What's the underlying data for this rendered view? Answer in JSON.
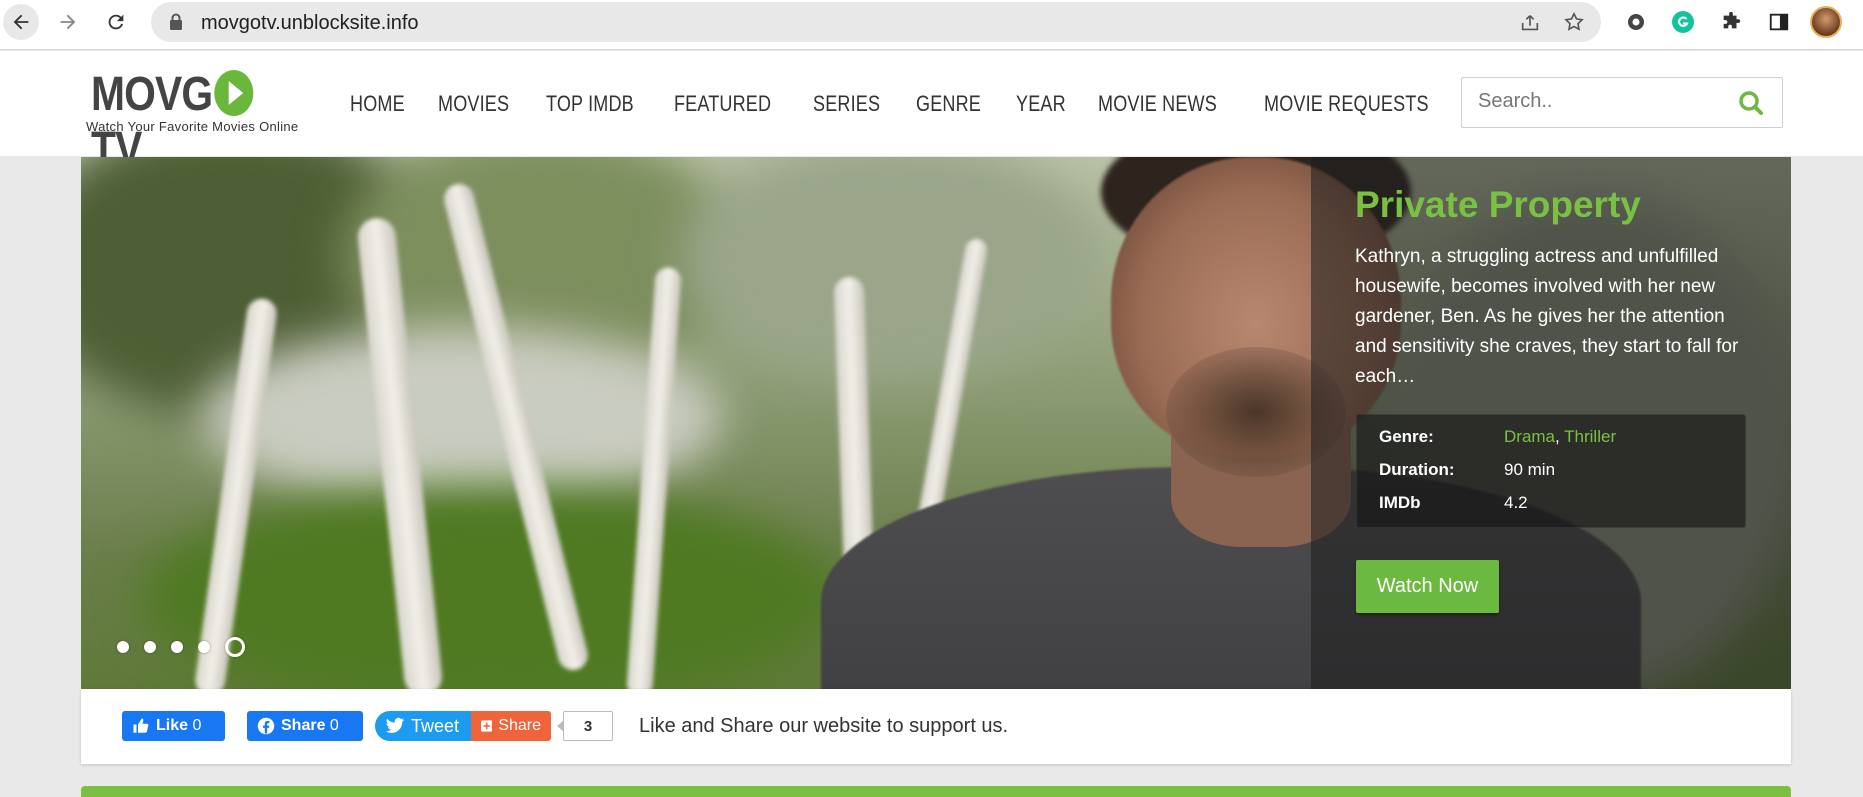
{
  "browser": {
    "url": "movgotv.unblocksite.info"
  },
  "site": {
    "logo_main": "MOVG",
    "logo_tv": "TV",
    "logo_tagline": "Watch Your Favorite Movies Online",
    "brand_color": "#7ac143",
    "menu": [
      "HOME",
      "MOVIES",
      "TOP IMDB",
      "FEATURED",
      "SERIES",
      "GENRE",
      "YEAR",
      "MOVIE NEWS",
      "MOVIE REQUESTS"
    ],
    "search_placeholder": "Search.."
  },
  "hero": {
    "title": "Private Property",
    "description": "Kathryn, a struggling actress and unfulfilled housewife, becomes involved with her new gardener, Ben. As he gives her the attention and sensitivity she craves, they start to fall for each…",
    "genre_label": "Genre:",
    "genres": [
      "Drama",
      "Thriller"
    ],
    "duration_label": "Duration:",
    "duration": "90 min",
    "imdb_label": "IMDb",
    "imdb": "4.2",
    "watch_label": "Watch Now",
    "slide_count": 5,
    "active_slide": 5
  },
  "social": {
    "like_label": "Like",
    "like_count": "0",
    "share_label": "Share",
    "share_count": "0",
    "tweet_label": "Tweet",
    "addshare_label": "Share",
    "addshare_count": "3",
    "support_text": "Like and Share our website to support us."
  }
}
